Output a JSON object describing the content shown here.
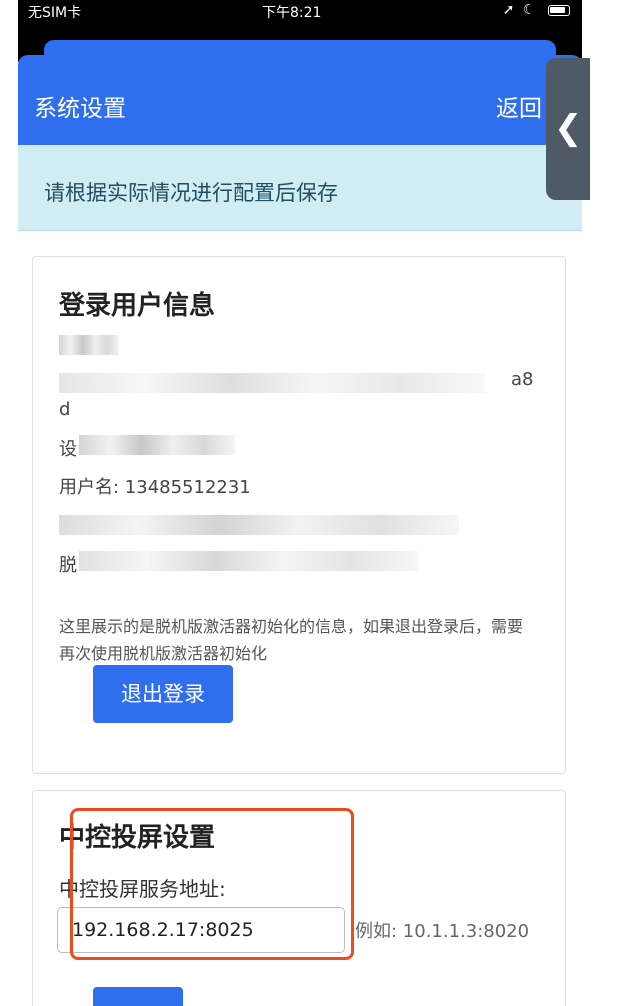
{
  "status_bar": {
    "carrier": "无SIM卡",
    "time": "下午8:21",
    "icons": "wifi-icon, location-icon, moon-icon, battery-icon"
  },
  "navbar": {
    "title": "系统设置",
    "back_label": "返回"
  },
  "side_tab": {
    "glyph": "❮"
  },
  "alert": {
    "text": "请根据实际情况进行配置后保存"
  },
  "login_panel": {
    "title": "登录用户信息",
    "line_a8": "a8",
    "line_d": "d",
    "line_set_prefix": "设",
    "username": "用户名: 13485512231",
    "line_offline_prefix": "脱",
    "note": "这里展示的是脱机版激活器初始化的信息，如果退出登录后，需要再次使用脱机版激活器初始化",
    "logout_label": "退出登录"
  },
  "screen_panel": {
    "title": "中控投屏设置",
    "address_label": "中控投屏服务地址:",
    "address_value": "192.168.2.17:8025",
    "hint": "例如: 10.1.1.3:8020"
  },
  "colors": {
    "primary": "#2f6fef",
    "alert_bg": "#d2ecf4",
    "highlight": "#ee4a22"
  }
}
